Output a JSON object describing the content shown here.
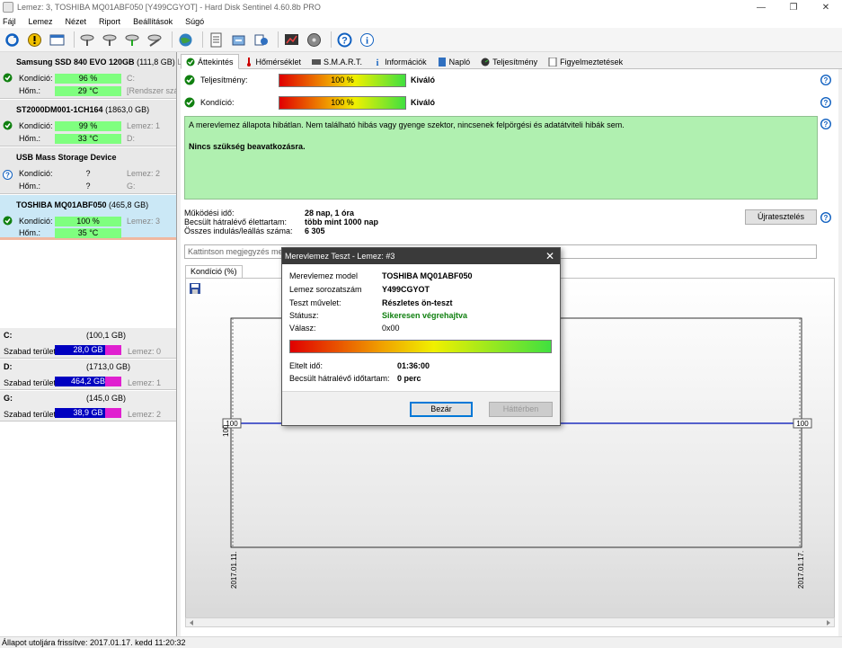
{
  "window": {
    "title": "Lemez: 3, TOSHIBA MQ01ABF050 [Y499CGYOT]  -  Hard Disk Sentinel 4.60.8b PRO",
    "min": "—",
    "max": "❐",
    "close": "✕"
  },
  "menu": [
    "Fájl",
    "Lemez",
    "Nézet",
    "Riport",
    "Beállítások",
    "Súgó"
  ],
  "toolbar_icons": [
    "refresh-icon",
    "alert-icon",
    "window-icon",
    "disk-test-icon",
    "disk-test-icon",
    "disk-test-icon",
    "disk-wand-icon",
    "globe-icon",
    "report-icon",
    "export-icon",
    "send-icon",
    "chart-icon",
    "disk-icon",
    "help-icon",
    "info-icon"
  ],
  "disks": [
    {
      "name": "Samsung SSD 840 EVO 120GB",
      "size": "(111,8 GB)",
      "extra_name": "Le",
      "cond_label": "Kondíció:",
      "cond_value": "96 %",
      "cond_extra": "C:",
      "temp_label": "Hőm.:",
      "temp_value": "29 °C",
      "temp_extra": "[Rendszer szá",
      "status": "ok"
    },
    {
      "name": "ST2000DM001-1CH164",
      "size": "(1863,0 GB)",
      "cond_label": "Kondíció:",
      "cond_value": "99 %",
      "cond_extra": "Lemez: 1",
      "temp_label": "Hőm.:",
      "temp_value": "33 °C",
      "temp_extra": "D:",
      "status": "ok"
    },
    {
      "name": "USB Mass Storage Device",
      "size": "",
      "cond_label": "Kondíció:",
      "cond_value": "?",
      "cond_extra": "Lemez: 2",
      "temp_label": "Hőm.:",
      "temp_value": "?",
      "temp_extra": "G:",
      "status": "unknown"
    },
    {
      "name": "TOSHIBA MQ01ABF050",
      "size": "(465,8 GB)",
      "cond_label": "Kondíció:",
      "cond_value": "100 %",
      "cond_extra": "Lemez: 3",
      "temp_label": "Hőm.:",
      "temp_value": "35 °C",
      "temp_extra": "",
      "status": "ok"
    }
  ],
  "volumes": [
    {
      "name": "C:",
      "size": "(100,1 GB)",
      "free_label": "Szabad terület",
      "free": "28,0 GB",
      "disk": "Lemez: 0"
    },
    {
      "name": "D:",
      "size": "(1713,0 GB)",
      "free_label": "Szabad terület",
      "free": "464,2 GB",
      "disk": "Lemez: 1"
    },
    {
      "name": "G:",
      "size": "(145,0 GB)",
      "free_label": "Szabad terület",
      "free": "38,9 GB",
      "disk": "Lemez: 2"
    }
  ],
  "tabs": [
    "Áttekintés",
    "Hőmérséklet",
    "S.M.A.R.T.",
    "Információk",
    "Napló",
    "Teljesítmény",
    "Figyelmeztetések"
  ],
  "overview": {
    "perf_label": "Teljesítmény:",
    "perf_value": "100 %",
    "perf_text": "Kiváló",
    "cond_label": "Kondíció:",
    "cond_value": "100 %",
    "cond_text": "Kiváló",
    "message": "A merevlemez állapota hibátlan. Nem található hibás vagy gyenge szektor, nincsenek felpörgési és adatátviteli hibák sem.",
    "action": "Nincs szükség beavatkozásra.",
    "uptime_label": "Működési idő:",
    "uptime": "28 nap, 1 óra",
    "life_label": "Becsült hátralévő élettartam:",
    "life": "több mint 1000 nap",
    "starts_label": "Összes indulás/leállás száma:",
    "starts": "6 305",
    "retest": "Újratesztelés",
    "note_placeholder": "Kattintson megjegyzés megadásához"
  },
  "graph": {
    "tab": "Kondíció  (%)",
    "ytick": "100",
    "x_start": "2017.01.11.",
    "x_end": "2017.01.17."
  },
  "chart_data": {
    "type": "line",
    "x": [
      "2017.01.11.",
      "2017.01.17."
    ],
    "series": [
      {
        "values": [
          100,
          100
        ]
      }
    ],
    "ylabel": "",
    "xlabel": ""
  },
  "dialog": {
    "title": "Merevlemez Teszt - Lemez: #3",
    "model_label": "Merevlemez model",
    "model": "TOSHIBA MQ01ABF050",
    "serial_label": "Lemez sorozatszám",
    "serial": "Y499CGYOT",
    "op_label": "Teszt művelet:",
    "op": "Részletes ön-teszt",
    "status_label": "Státusz:",
    "status": "Sikeresen végrehajtva",
    "answer_label": "Válasz:",
    "answer": "0x00",
    "progress": 1.0,
    "elapsed_label": "Eltelt idő:",
    "elapsed": "01:36:00",
    "remaining_label": "Becsült hátralévő időtartam:",
    "remaining": "0 perc",
    "close_btn": "Bezár",
    "bg_btn": "Háttérben"
  },
  "statusbar": "Állapot utoljára frissítve: 2017.01.17. kedd 11:20:32"
}
